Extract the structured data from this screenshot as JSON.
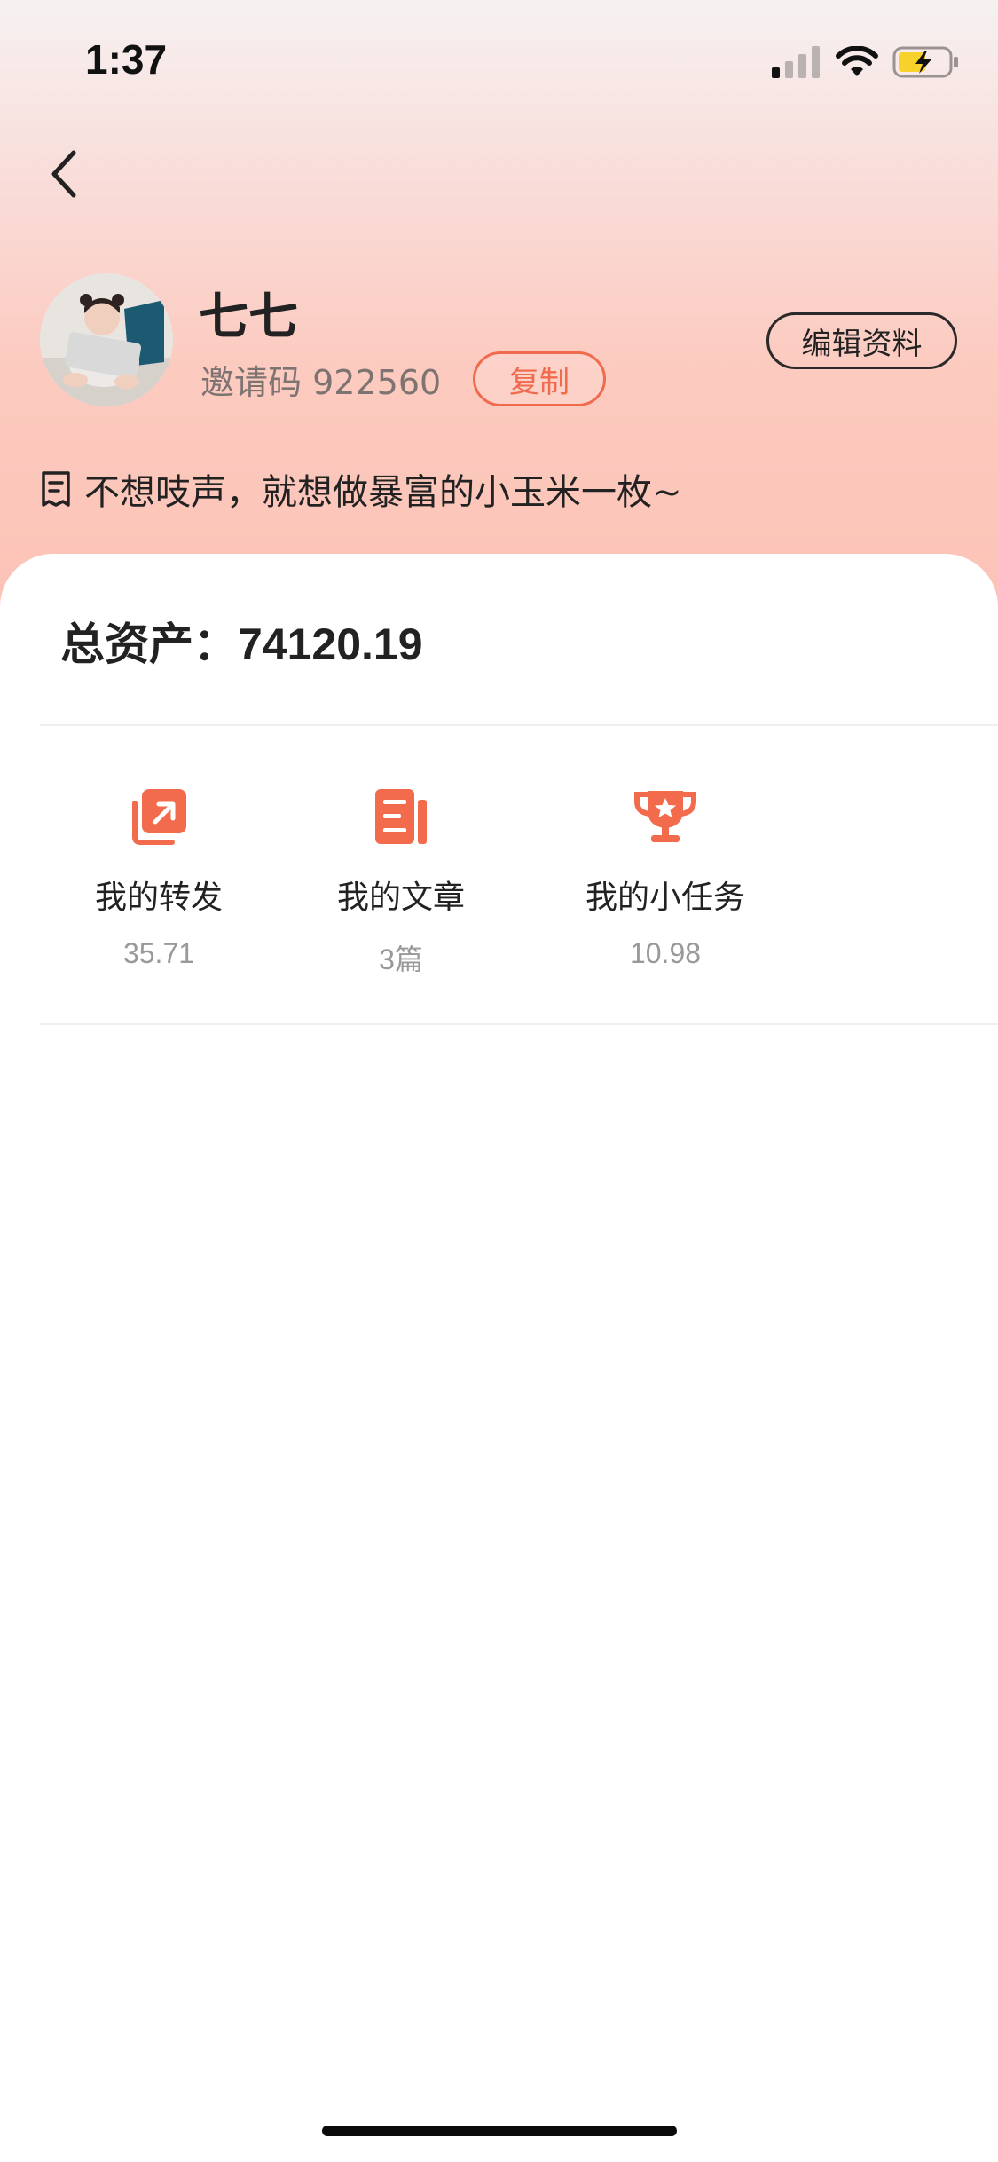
{
  "status_bar": {
    "time": "1:37"
  },
  "profile": {
    "name": "七七",
    "invite_code_label": "邀请码",
    "invite_code": "922560",
    "copy_label": "复制",
    "edit_label": "编辑资料",
    "bio": "不想吱声，就想做暴富的小玉米一枚~"
  },
  "assets": {
    "label": "总资产：",
    "amount": "74120.19"
  },
  "menu": [
    {
      "label": "我的转发",
      "value": "35.71",
      "icon": "share-forward-icon"
    },
    {
      "label": "我的文章",
      "value": "3篇",
      "icon": "article-icon"
    },
    {
      "label": "我的小任务",
      "value": "10.98",
      "icon": "trophy-icon"
    }
  ],
  "colors": {
    "accent": "#f06a4d",
    "header_gradient_top": "#f6f1f1",
    "header_gradient_bottom": "#fcc3b6",
    "battery": "#f8d22a"
  }
}
